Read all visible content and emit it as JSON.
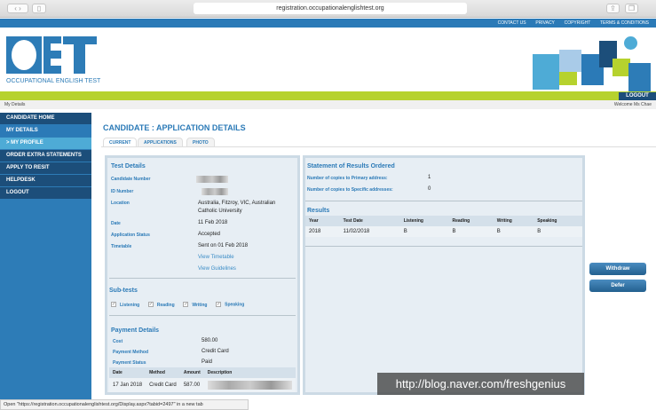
{
  "browser": {
    "url": "registration.occupationalenglishtest.org",
    "status": "Open \"https://registration.occupationalenglishtest.org/Display.aspx?tabid=2497\" in a new tab"
  },
  "toplinks": [
    "CONTACT US",
    "PRIVACY",
    "COPYRIGHT",
    "TERMS & CONDITIONS"
  ],
  "logo": {
    "letters": "OET",
    "subtitle": "OCCUPATIONAL ENGLISH TEST"
  },
  "logout_top": "LOGOUT",
  "breadcrumb": "My Details",
  "welcome": "Welcome Ms Chae",
  "sidebar": [
    "CANDIDATE HOME",
    "MY DETAILS",
    "> MY PROFILE",
    "ORDER EXTRA STATEMENTS",
    "APPLY TO RESIT",
    "HELPDESK",
    "LOGOUT"
  ],
  "title": "CANDIDATE : APPLICATION DETAILS",
  "tabs": [
    "CURRENT",
    "APPLICATIONS",
    "PHOTO"
  ],
  "test_details": {
    "heading": "Test Details",
    "labels": [
      "Candidate Number",
      "ID Number",
      "Location",
      "Date",
      "Application Status",
      "Timetable"
    ],
    "location": "Australia, Fitzroy, VIC, Australian Catholic University",
    "date": "11 Feb 2018",
    "status": "Accepted",
    "timetable": "Sent on 01 Feb 2018",
    "view_timetable": "View Timetable",
    "view_guidelines": "View Guidelines"
  },
  "subtests": {
    "heading": "Sub-tests",
    "items": [
      "Listening",
      "Reading",
      "Writing",
      "Speaking"
    ]
  },
  "payment": {
    "heading": "Payment Details",
    "labels": [
      "Cost",
      "Payment Method",
      "Payment Status"
    ],
    "cost": "580.00",
    "method": "Credit Card",
    "status": "Paid",
    "columns": [
      "Date",
      "Method",
      "Amount",
      "Description"
    ],
    "row": [
      "17 Jan 2018",
      "Credit Card",
      "587.00"
    ]
  },
  "statement": {
    "heading": "Statement of Results Ordered",
    "primary_label": "Number of copies to Primary address:",
    "primary": "1",
    "specific_label": "Number of copies to Specific addresses:",
    "specific": "0"
  },
  "results": {
    "heading": "Results",
    "columns": [
      "Year",
      "Test Date",
      "Listening",
      "Reading",
      "Writing",
      "Speaking"
    ],
    "row": [
      "2018",
      "11/02/2018",
      "B",
      "B",
      "B",
      "B"
    ]
  },
  "buttons": {
    "withdraw": "Withdraw",
    "defer": "Defer"
  },
  "watermark": "http://blog.naver.com/freshgenius"
}
